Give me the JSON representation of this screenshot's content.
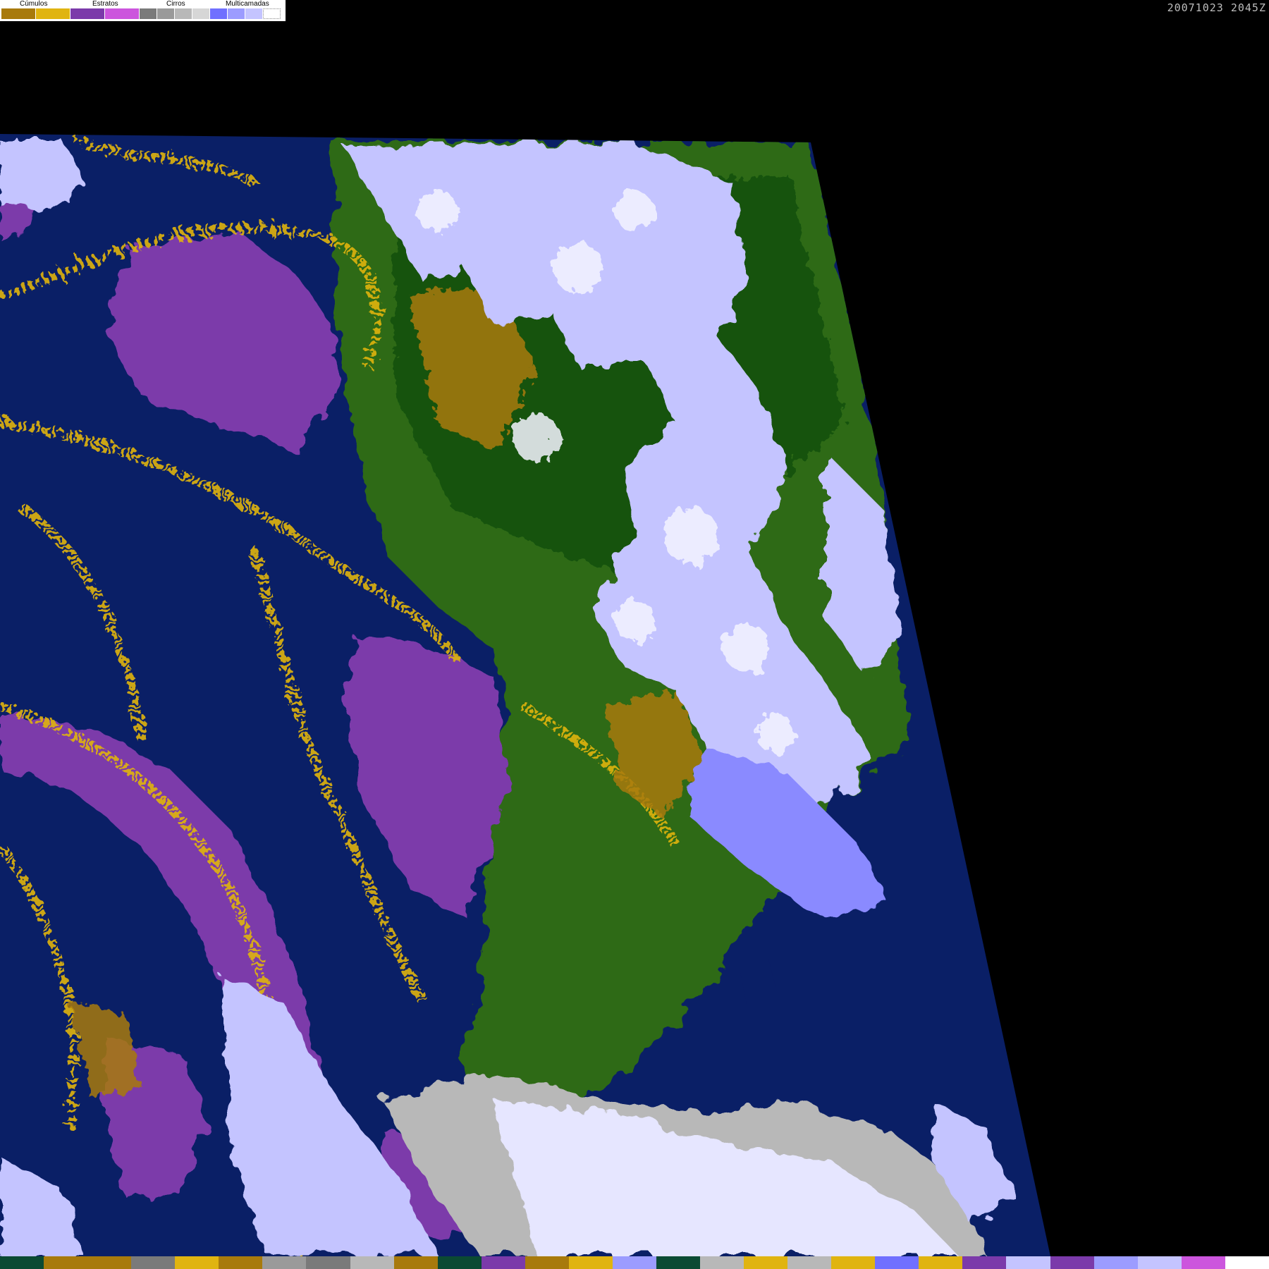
{
  "legend": {
    "cumulos_label": "Cúmulos",
    "estratos_label": "Estratos",
    "cirros_label": "Cirros",
    "multicamadas_label": "Multicamadas",
    "swatches": [
      "#a87a0c",
      "#e0b410",
      "#7b3aaa",
      "#cc55dd",
      "#7a7a7a",
      "#9a9a9a",
      "#b8b8b8",
      "#d6d6d6",
      "#7070ff",
      "#9c9cff",
      "#c4c4ff",
      "#ffffff"
    ]
  },
  "timestamp": "20071023 2045Z",
  "colors": {
    "ocean": "#0a1f66",
    "land_green": "#2f6a14",
    "land_dark": "#12520f",
    "cumulus_dark": "#a87a0c",
    "cumulus_yellow": "#e0b410",
    "stratus": "#7b3aaa",
    "stratus_light": "#cc55dd",
    "cirrus": "#9a9a9a",
    "multilayer": "#c4c4ff",
    "multilayer_blue": "#8a8aff",
    "white": "#f4f4ff"
  },
  "bottom_strip": [
    "#0b4a33",
    "#a87a0c",
    "#a87a0c",
    "#7a7a7a",
    "#e0b410",
    "#a87a0c",
    "#9a9a9a",
    "#7a7a7a",
    "#b8b8b8",
    "#a87a0c",
    "#0b4a33",
    "#7b3aaa",
    "#a87a0c",
    "#e0b410",
    "#9c9cff",
    "#0b4a33",
    "#b8b8b8",
    "#e0b410",
    "#b8b8b8",
    "#e0b410",
    "#7070ff",
    "#e0b410",
    "#7b3aaa",
    "#c4c4ff",
    "#7b3aaa",
    "#9c9cff",
    "#c4c4ff",
    "#cc55dd",
    "#ffffff"
  ]
}
